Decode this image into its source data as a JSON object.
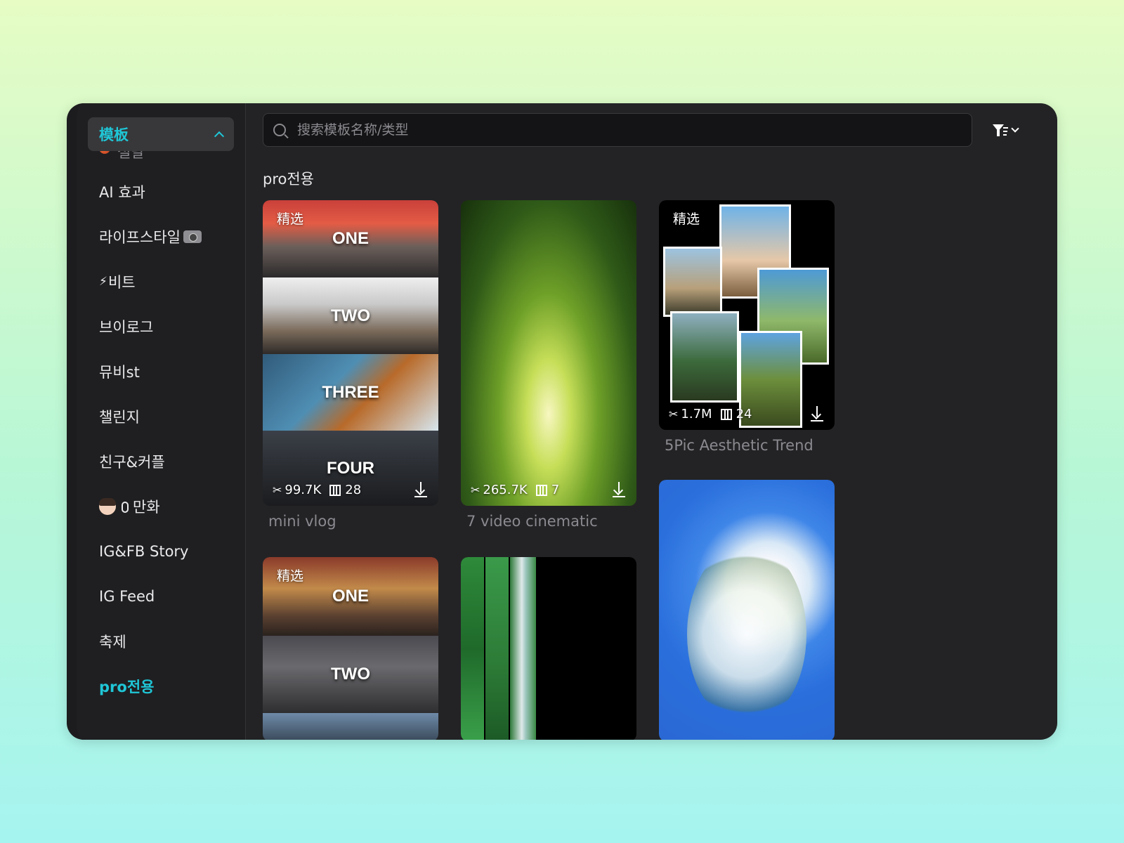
{
  "sidebar": {
    "header": "模板",
    "items": [
      {
        "label": "설날",
        "icon": "lantern-icon"
      },
      {
        "label": "AI 효과"
      },
      {
        "label": "라이프스타일",
        "icon": "camera-icon"
      },
      {
        "label": "비트",
        "icon": "lightning-icon"
      },
      {
        "label": "브이로그"
      },
      {
        "label": "뮤비st"
      },
      {
        "label": "챌린지"
      },
      {
        "label": "친구&커플"
      },
      {
        "label": "만화",
        "icon": "face-mic-icon"
      },
      {
        "label": "IG&FB Story"
      },
      {
        "label": "IG Feed"
      },
      {
        "label": "축제"
      },
      {
        "label": "pro전용",
        "active": true
      }
    ]
  },
  "search": {
    "placeholder": "搜索模板名称/类型",
    "value": ""
  },
  "section": {
    "title": "pro전용"
  },
  "colors": {
    "accent": "#1fc6d6",
    "bg": "#232325",
    "sidebar": "#1f1f21"
  },
  "cards": [
    {
      "badge": "精选",
      "strip_labels": [
        "ONE",
        "TWO",
        "THREE",
        "FOUR"
      ],
      "uses": "99.7K",
      "clips": "28",
      "title": "mini vlog"
    },
    {
      "badge": "",
      "uses": "265.7K",
      "clips": "7",
      "title": "7 video cinematic"
    },
    {
      "badge": "精选",
      "uses": "1.7M",
      "clips": "24",
      "title": "5Pic Aesthetic Trend"
    },
    {
      "badge": "精选",
      "strip_labels": [
        "ONE",
        "TWO"
      ]
    },
    {
      "badge": ""
    },
    {
      "badge": ""
    }
  ]
}
